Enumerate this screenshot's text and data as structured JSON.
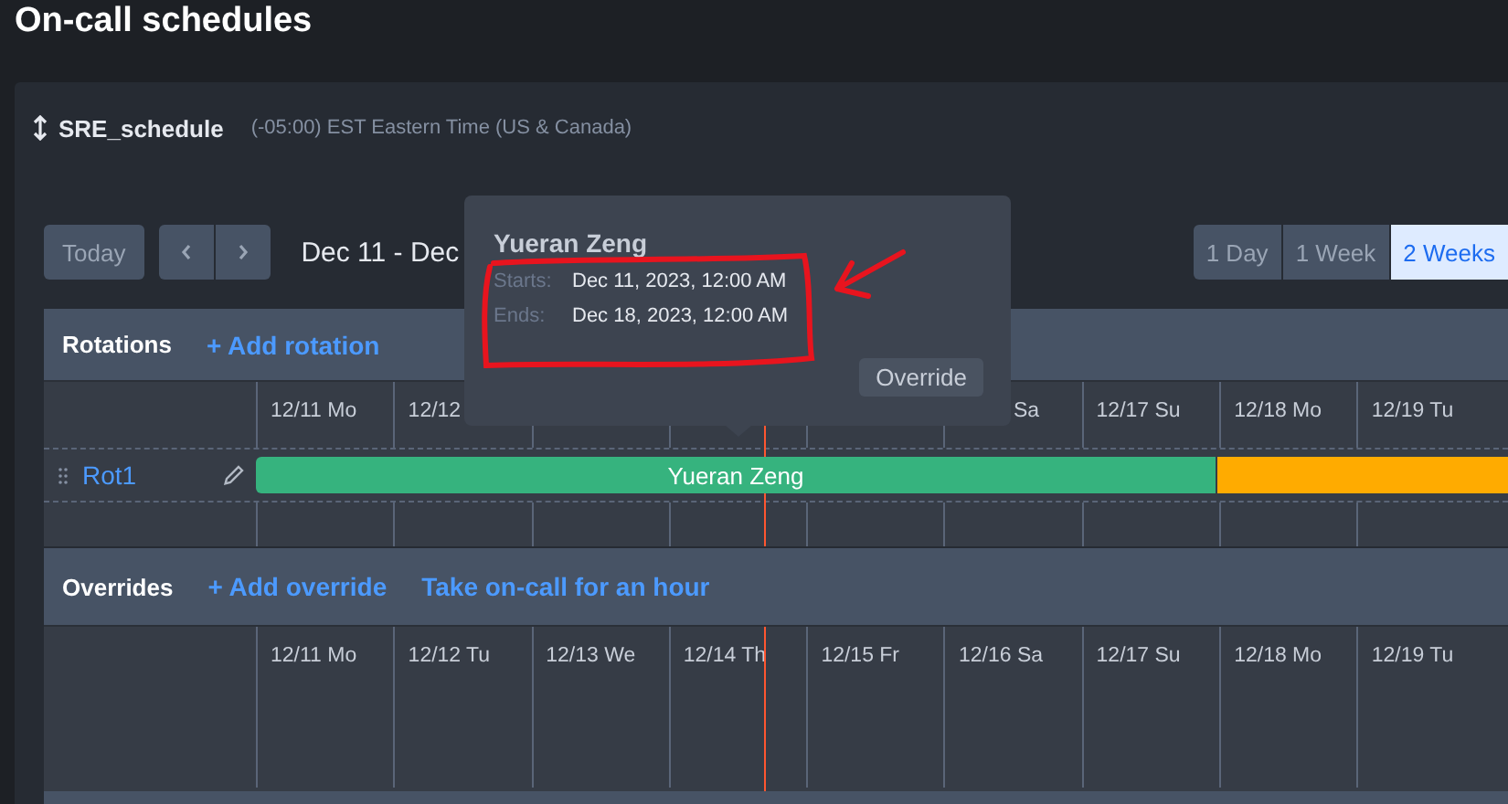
{
  "page_title": "On-call schedules",
  "schedule": {
    "name": "SRE_schedule",
    "timezone": "(-05:00) EST Eastern Time (US & Canada)"
  },
  "toolbar": {
    "today": "Today",
    "date_range": "Dec 11 - Dec",
    "views": [
      {
        "label": "1 Day",
        "selected": false
      },
      {
        "label": "1 Week",
        "selected": false
      },
      {
        "label": "2 Weeks",
        "selected": true
      }
    ]
  },
  "rotations": {
    "title": "Rotations",
    "add_link": "+ Add rotation",
    "days": [
      {
        "label": "12/11 Mo"
      },
      {
        "label": "12/12"
      },
      {
        "label": "Sa"
      },
      {
        "label": "12/17 Su"
      },
      {
        "label": "12/18 Mo"
      },
      {
        "label": "12/19 Tu"
      }
    ],
    "rows": [
      {
        "name": "Rot1",
        "segments": [
          {
            "label": "Yueran Zeng",
            "color": "#36b37e"
          },
          {
            "color": "#ffab00"
          }
        ]
      }
    ]
  },
  "overrides": {
    "title": "Overrides",
    "links": [
      "+ Add override",
      "Take on-call for an hour"
    ],
    "days": [
      {
        "label": "12/11 Mo"
      },
      {
        "label": "12/12 Tu"
      },
      {
        "label": "12/13 We"
      },
      {
        "label": "12/14 Th"
      },
      {
        "label": "12/15 Fr"
      },
      {
        "label": "12/16 Sa"
      },
      {
        "label": "12/17 Su"
      },
      {
        "label": "12/18 Mo"
      },
      {
        "label": "12/19 Tu"
      }
    ]
  },
  "popup": {
    "name": "Yueran Zeng",
    "rows": [
      {
        "label": "Starts:",
        "value": "Dec 11, 2023, 12:00 AM"
      },
      {
        "label": "Ends:",
        "value": "Dec 18, 2023, 12:00 AM"
      }
    ],
    "button": "Override"
  }
}
